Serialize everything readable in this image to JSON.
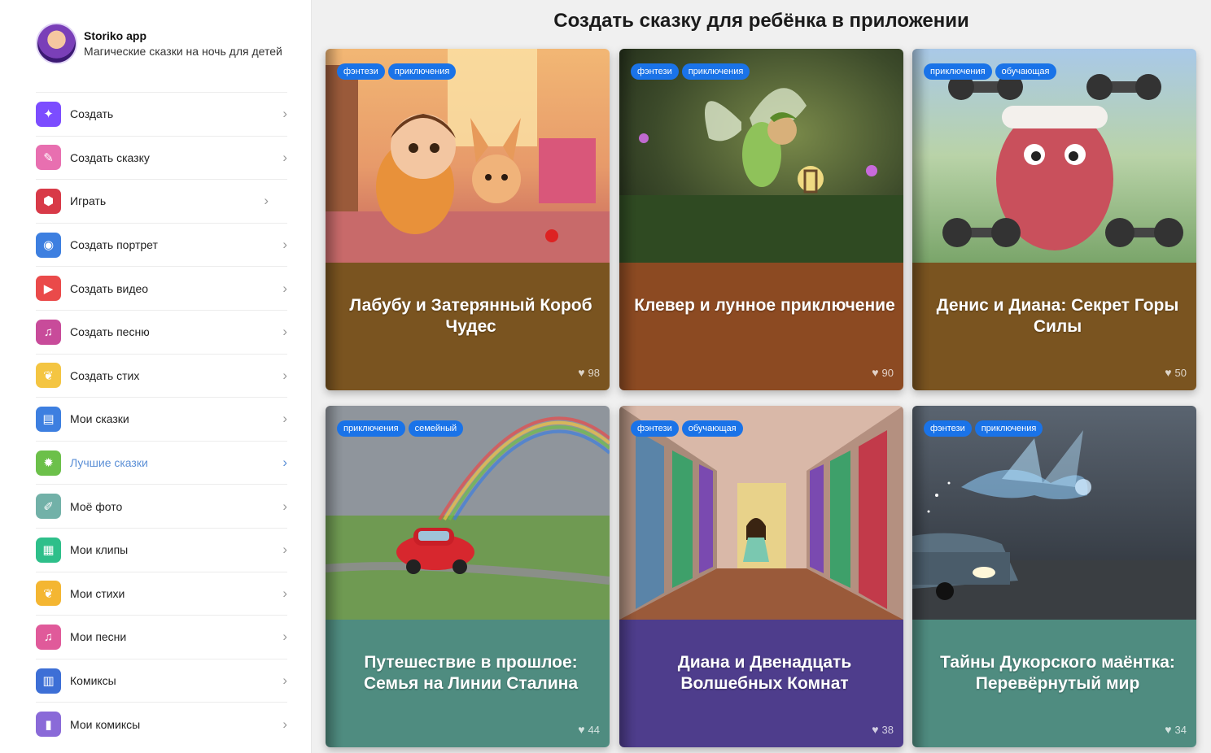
{
  "profile": {
    "name": "Storiko app",
    "subtitle": "Магические сказки на ночь для детей"
  },
  "menu": [
    {
      "label": "Создать",
      "icon": "magic-wand-icon",
      "color": "#7c4dff",
      "glyph": "✦"
    },
    {
      "label": "Создать сказку",
      "icon": "feather-icon",
      "color": "#e86fb0",
      "glyph": "✎"
    },
    {
      "label": "Играть",
      "icon": "dice-icon",
      "color": "#d83a48",
      "glyph": "⬢"
    },
    {
      "label": "Создать портрет",
      "icon": "camera-icon",
      "color": "#3d7fe0",
      "glyph": "◉"
    },
    {
      "label": "Создать видео",
      "icon": "video-icon",
      "color": "#ea4a4a",
      "glyph": "▶"
    },
    {
      "label": "Создать песню",
      "icon": "music-note-icon",
      "color": "#c84b9a",
      "glyph": "♫"
    },
    {
      "label": "Создать стих",
      "icon": "leaf-icon",
      "color": "#f4c542",
      "glyph": "❦"
    },
    {
      "label": "Мои сказки",
      "icon": "book-icon",
      "color": "#3d7fe0",
      "glyph": "▤"
    },
    {
      "label": "Лучшие сказки",
      "icon": "flame-icon",
      "color": "#6cc04a",
      "glyph": "✹"
    },
    {
      "label": "Моё фото",
      "icon": "brush-icon",
      "color": "#72b1a8",
      "glyph": "✐"
    },
    {
      "label": "Мои клипы",
      "icon": "film-icon",
      "color": "#2ebf8a",
      "glyph": "▦"
    },
    {
      "label": "Мои стихи",
      "icon": "leaf-icon",
      "color": "#f4b632",
      "glyph": "❦"
    },
    {
      "label": "Мои песни",
      "icon": "music-note-icon",
      "color": "#e05a9a",
      "glyph": "♫"
    },
    {
      "label": "Комиксы",
      "icon": "open-book-icon",
      "color": "#3d6fd6",
      "glyph": "▥"
    },
    {
      "label": "Мои комиксы",
      "icon": "bookmark-icon",
      "color": "#8a6ad8",
      "glyph": "▮"
    }
  ],
  "active_menu": "Лучшие сказки",
  "main": {
    "title": "Создать сказку для ребёнка в приложении"
  },
  "cards": [
    {
      "title": "Лабубу и Затерянный Короб Чудес",
      "tags": [
        "фэнтези",
        "приключения"
      ],
      "likes": "98",
      "color": "#7a5420"
    },
    {
      "title": "Клевер и лунное приключение",
      "tags": [
        "фэнтези",
        "приключения"
      ],
      "likes": "90",
      "color": "#8c4a22"
    },
    {
      "title": "Денис и Диана: Секрет Горы Силы",
      "tags": [
        "приключения",
        "обучающая"
      ],
      "likes": "50",
      "color": "#7a5420"
    },
    {
      "title": "Путешествие в прошлое: Семья на Линии Сталина",
      "tags": [
        "приключения",
        "семейный"
      ],
      "likes": "44",
      "color": "#4f8c80"
    },
    {
      "title": "Диана и Двенадцать Волшебных Комнат",
      "tags": [
        "фэнтези",
        "обучающая"
      ],
      "likes": "38",
      "color": "#4e3d8c"
    },
    {
      "title": "Тайны Дукорского маёнтка: Перевёрнутый мир",
      "tags": [
        "фэнтези",
        "приключения"
      ],
      "likes": "34",
      "color": "#4f8c80"
    }
  ]
}
